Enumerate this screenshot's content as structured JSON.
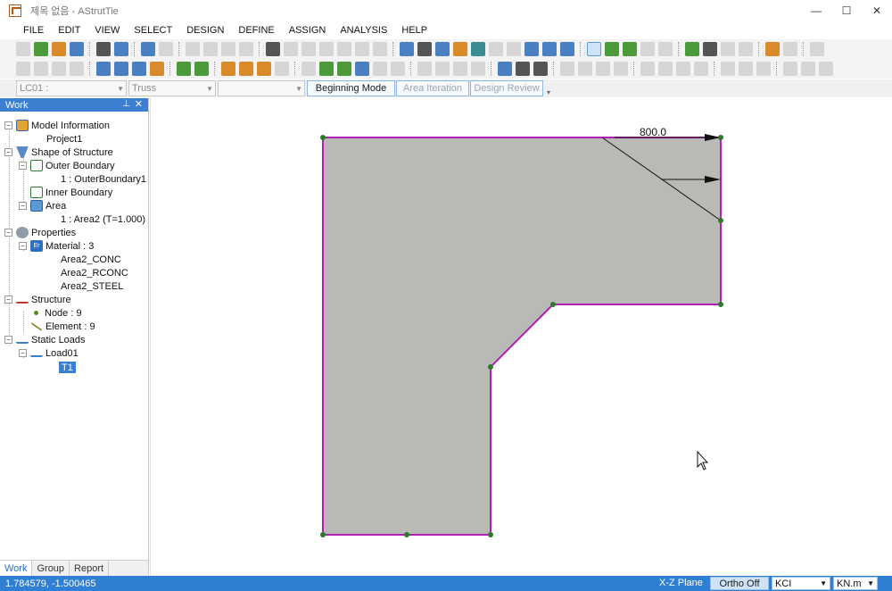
{
  "window": {
    "title": "제목 없음 - AStrutTie",
    "minimize": "—",
    "maximize": "☐",
    "close": "✕"
  },
  "menu": [
    "FILE",
    "EDIT",
    "VIEW",
    "SELECT",
    "DESIGN",
    "DEFINE",
    "ASSIGN",
    "ANALYSIS",
    "HELP"
  ],
  "combos": {
    "load_case": "LC01 :",
    "model_type": "Truss",
    "blank": ""
  },
  "modes": {
    "beginning": "Beginning Mode",
    "area_iteration": "Area Iteration",
    "design_review": "Design Review"
  },
  "work_panel": {
    "title": "Work",
    "pin": "📌",
    "close": "✕",
    "tree": {
      "model_information": "Model Information",
      "project": "Project1",
      "shape_of_structure": "Shape of Structure",
      "outer_boundary": "Outer Boundary",
      "outer_boundary_item": "1 : OuterBoundary1",
      "inner_boundary": "Inner Boundary",
      "area": "Area",
      "area_item": "1 : Area2 (T=1.000)",
      "properties": "Properties",
      "material": "Material : 3",
      "materials": [
        "Area2_CONC",
        "Area2_RCONC",
        "Area2_STEEL"
      ],
      "structure": "Structure",
      "node": "Node : 9",
      "element": "Element : 9",
      "static_loads": "Static Loads",
      "load": "Load01",
      "load_item": "T1"
    },
    "tabs": [
      "Work",
      "Group",
      "Report"
    ]
  },
  "canvas": {
    "dimension_label": "800.0",
    "fill_color": "#b9b9b5",
    "boundary_color": "#b020b0",
    "node_color": "#2a7a2a"
  },
  "status": {
    "coords": "1.784579, -1.500465",
    "plane": "X-Z Plane",
    "ortho": "Ortho Off",
    "code": "KCI",
    "unit": "KN.m"
  },
  "colors": {
    "accent": "#2f7fd4",
    "panel_header": "#3c7fd1"
  }
}
